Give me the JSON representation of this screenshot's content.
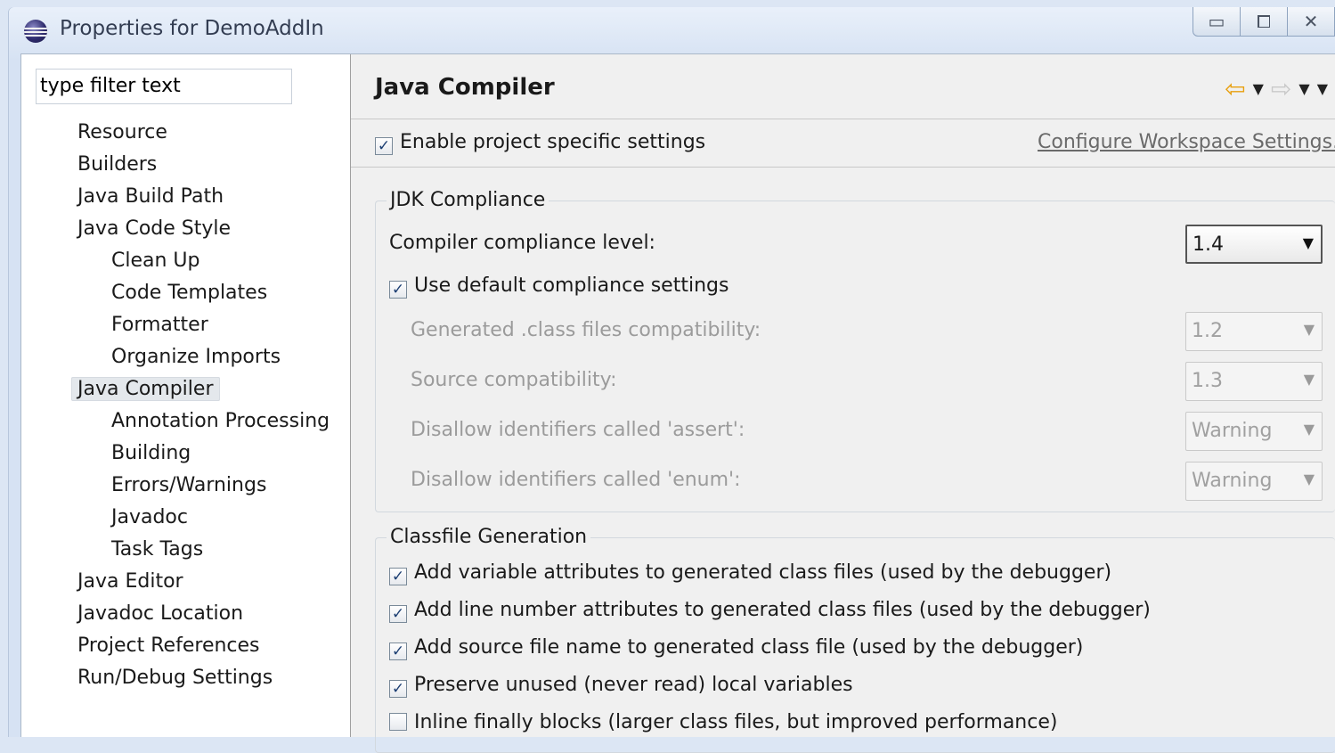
{
  "window": {
    "title": "Properties for DemoAddIn",
    "controls": {
      "minimize": "▭",
      "maximize": "⧠",
      "close": "✕"
    }
  },
  "sidebar": {
    "filter_placeholder": "type filter text",
    "items": [
      {
        "label": "Resource",
        "level": 0
      },
      {
        "label": "Builders",
        "level": 0
      },
      {
        "label": "Java Build Path",
        "level": 0
      },
      {
        "label": "Java Code Style",
        "level": 0
      },
      {
        "label": "Clean Up",
        "level": 1
      },
      {
        "label": "Code Templates",
        "level": 1
      },
      {
        "label": "Formatter",
        "level": 1
      },
      {
        "label": "Organize Imports",
        "level": 1
      },
      {
        "label": "Java Compiler",
        "level": 0,
        "selected": true
      },
      {
        "label": "Annotation Processing",
        "level": 1
      },
      {
        "label": "Building",
        "level": 1
      },
      {
        "label": "Errors/Warnings",
        "level": 1
      },
      {
        "label": "Javadoc",
        "level": 1
      },
      {
        "label": "Task Tags",
        "level": 1
      },
      {
        "label": "Java Editor",
        "level": 0
      },
      {
        "label": "Javadoc Location",
        "level": 0
      },
      {
        "label": "Project References",
        "level": 0
      },
      {
        "label": "Run/Debug Settings",
        "level": 0
      }
    ]
  },
  "page": {
    "title": "Java Compiler",
    "enable_project_specific": {
      "label": "Enable project specific settings",
      "checked": true
    },
    "configure_link": "Configure Workspace Settings...",
    "jdk_group": {
      "title": "JDK Compliance",
      "compliance_label": "Compiler compliance level:",
      "compliance_value": "1.4",
      "use_default": {
        "label": "Use default compliance settings",
        "checked": true
      },
      "generated_label": "Generated .class files compatibility:",
      "generated_value": "1.2",
      "source_label": "Source compatibility:",
      "source_value": "1.3",
      "assert_label": "Disallow identifiers called 'assert':",
      "assert_value": "Warning",
      "enum_label": "Disallow identifiers called 'enum':",
      "enum_value": "Warning"
    },
    "classfile_group": {
      "title": "Classfile Generation",
      "options": [
        {
          "label": "Add variable attributes to generated class files (used by the debugger)",
          "checked": true
        },
        {
          "label": "Add line number attributes to generated class files (used by the debugger)",
          "checked": true
        },
        {
          "label": "Add source file name to generated class file (used by the debugger)",
          "checked": true
        },
        {
          "label": "Preserve unused (never read) local variables",
          "checked": true
        },
        {
          "label": "Inline finally blocks (larger class files, but improved performance)",
          "checked": false
        }
      ]
    }
  },
  "colors": {
    "accent": "#e8a010",
    "link": "#6a6a6a",
    "disabled_text": "#9b9b9b",
    "selection": "#e4e8ec"
  }
}
